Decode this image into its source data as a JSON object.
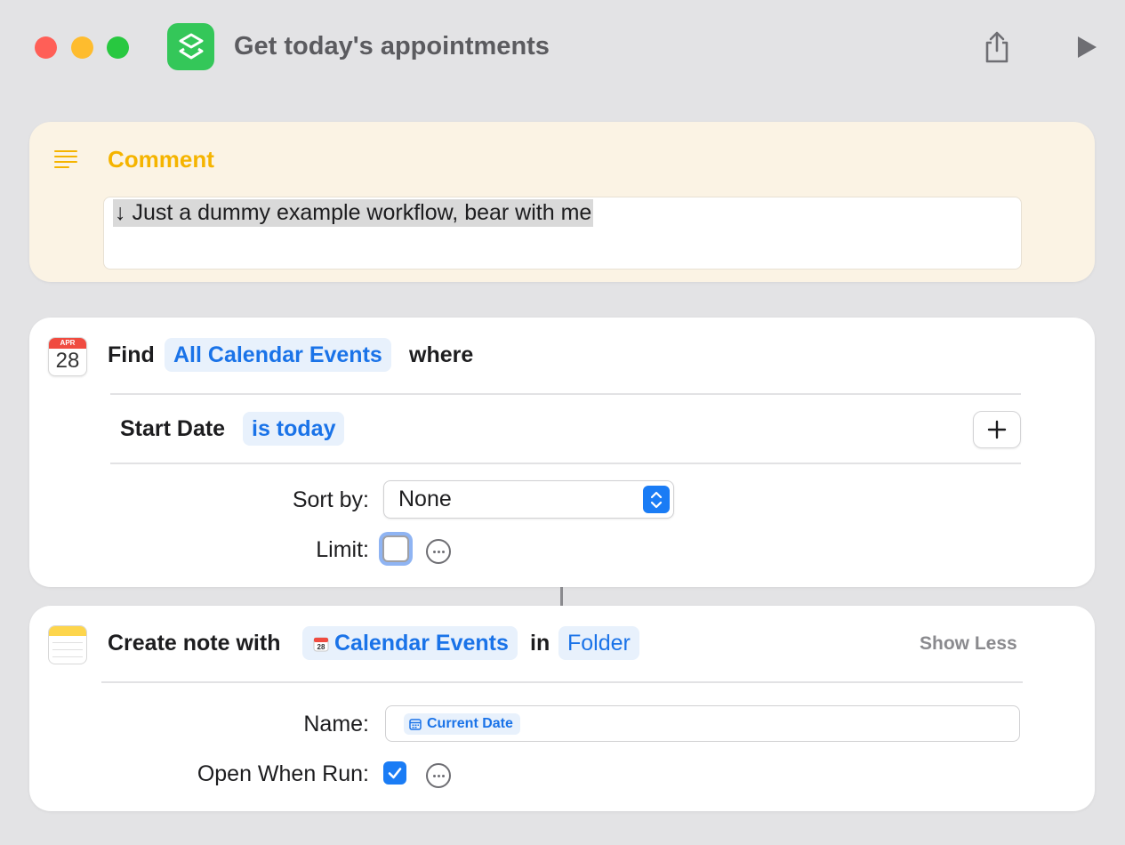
{
  "window": {
    "title": "Get today's appointments"
  },
  "toolbar": {
    "share_icon": "share-icon",
    "run_icon": "play-icon"
  },
  "comment": {
    "title": "Comment",
    "text": "↓ Just a dummy example workflow, bear with me"
  },
  "find_action": {
    "icon_month": "APR",
    "icon_day": "28",
    "find_label": "Find",
    "source_token": "All Calendar Events",
    "where_label": "where",
    "filter_field": "Start Date",
    "filter_condition": "is today",
    "sort_label": "Sort by:",
    "sort_value": "None",
    "limit_label": "Limit:",
    "limit_checked": false
  },
  "note_action": {
    "label": "Create note with",
    "input_token": "Calendar Events",
    "in_label": "in",
    "folder_token": "Folder",
    "show_less": "Show Less",
    "name_label": "Name:",
    "name_token": "Current Date",
    "open_label": "Open When Run:",
    "open_checked": true
  },
  "colors": {
    "accent": "#1a7cf5",
    "comment_title": "#f5b400",
    "comment_bg": "#fbf3e4",
    "app_icon": "#34c759"
  }
}
